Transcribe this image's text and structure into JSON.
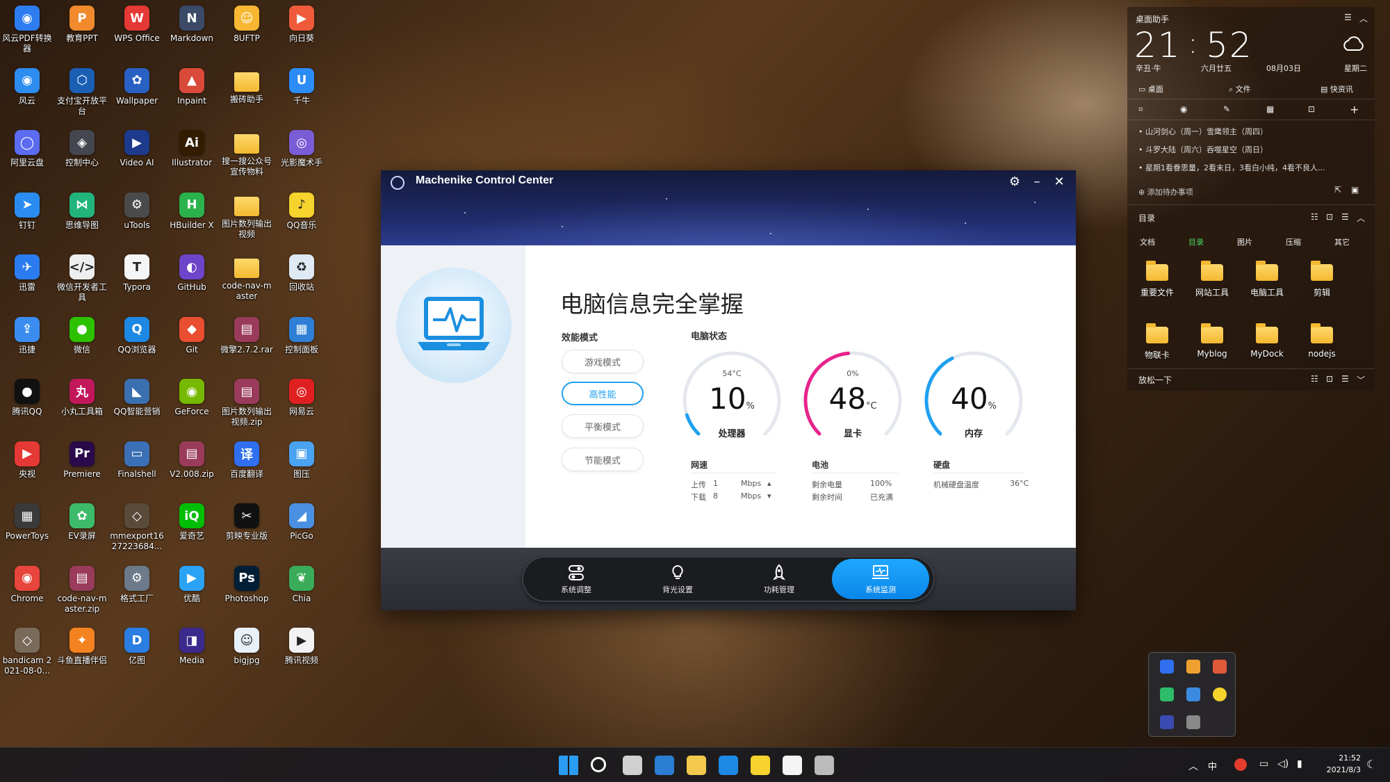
{
  "desktop": {
    "icons": [
      {
        "label": "风云PDF转换器",
        "icon": "pdf-converter-icon",
        "color": "#2d7cf0",
        "glyph": "◉"
      },
      {
        "label": "教育PPT",
        "icon": "edu-ppt-icon",
        "color": "#f08a2d",
        "glyph": "P"
      },
      {
        "label": "WPS Office",
        "icon": "wps-icon",
        "color": "#e53935",
        "glyph": "W"
      },
      {
        "label": "Markdown",
        "icon": "markdown-icon",
        "color": "#3b4a66",
        "glyph": "N"
      },
      {
        "label": "8UFTP",
        "icon": "ftp-icon",
        "color": "#f7b733",
        "glyph": "☺"
      },
      {
        "label": "向日葵",
        "icon": "sunflower-icon",
        "color": "#ef5b3a",
        "glyph": "▶"
      },
      {
        "label": "风云",
        "icon": "fengyun-icon",
        "color": "#2d8cf0",
        "glyph": "◉"
      },
      {
        "label": "支付宝开放平台",
        "icon": "alipay-dev-icon",
        "color": "#1a5fb4",
        "glyph": "⬡"
      },
      {
        "label": "Wallpaper",
        "icon": "wallpaper-icon",
        "color": "#2860c4",
        "glyph": "✿"
      },
      {
        "label": "Inpaint",
        "icon": "inpaint-icon",
        "color": "#d94a3a",
        "glyph": "▲"
      },
      {
        "label": "搬砖助手",
        "icon": "folder-icon",
        "color": "#f3c13a",
        "glyph": ""
      },
      {
        "label": "千牛",
        "icon": "qianniu-icon",
        "color": "#2b8cf5",
        "glyph": "U"
      },
      {
        "label": "阿里云盘",
        "icon": "aliyun-drive-icon",
        "color": "#5b6cf0",
        "glyph": "◯"
      },
      {
        "label": "控制中心",
        "icon": "control-center-icon",
        "color": "#44474f",
        "glyph": "◈"
      },
      {
        "label": "Video AI",
        "icon": "video-ai-icon",
        "color": "#1d3a8c",
        "glyph": "▶"
      },
      {
        "label": "Illustrator",
        "icon": "illustrator-icon",
        "color": "#331c00",
        "glyph": "Ai"
      },
      {
        "label": "搜一搜公众号宣传物料",
        "icon": "folder-icon",
        "color": "#f3c13a",
        "glyph": ""
      },
      {
        "label": "光影魔术手",
        "icon": "nevercenter-icon",
        "color": "#7a5cd6",
        "glyph": "◎"
      },
      {
        "label": "钉钉",
        "icon": "dingtalk-icon",
        "color": "#2a8cf0",
        "glyph": "➤"
      },
      {
        "label": "思维导图",
        "icon": "mindmap-icon",
        "color": "#21b47c",
        "glyph": "⋈"
      },
      {
        "label": "uTools",
        "icon": "utools-icon",
        "color": "#4a4a4a",
        "glyph": "⚙"
      },
      {
        "label": "HBuilder X",
        "icon": "hbuilder-icon",
        "color": "#2bb24c",
        "glyph": "H"
      },
      {
        "label": "图片数列输出视频",
        "icon": "folder-icon",
        "color": "#f3c13a",
        "glyph": ""
      },
      {
        "label": "QQ音乐",
        "icon": "qqmusic-icon",
        "color": "#f6d32d",
        "glyph": "♪"
      },
      {
        "label": "迅雷",
        "icon": "xunlei-icon",
        "color": "#2b7cf0",
        "glyph": "✈"
      },
      {
        "label": "微信开发者工具",
        "icon": "wechat-dev-icon",
        "color": "#eeeeee",
        "glyph": "</>"
      },
      {
        "label": "Typora",
        "icon": "typora-icon",
        "color": "#f5f5f5",
        "glyph": "T"
      },
      {
        "label": "GitHub",
        "icon": "github-icon",
        "color": "#6e44c9",
        "glyph": "◐"
      },
      {
        "label": "code-nav-master",
        "icon": "folder-icon",
        "color": "#f3c13a",
        "glyph": ""
      },
      {
        "label": "回收站",
        "icon": "recycle-bin-icon",
        "color": "#dfeaf5",
        "glyph": "♻"
      },
      {
        "label": "迅捷",
        "icon": "xunjie-icon",
        "color": "#3b8cf0",
        "glyph": "⇪"
      },
      {
        "label": "微信",
        "icon": "wechat-icon",
        "color": "#2dc100",
        "glyph": "●"
      },
      {
        "label": "QQ浏览器",
        "icon": "qq-browser-icon",
        "color": "#1e88e5",
        "glyph": "Q"
      },
      {
        "label": "Git",
        "icon": "git-icon",
        "color": "#e94e31",
        "glyph": "◆"
      },
      {
        "label": "微擎2.7.2.rar",
        "icon": "rar-archive-icon",
        "color": "#9a3b5b",
        "glyph": "▤"
      },
      {
        "label": "控制面板",
        "icon": "control-panel-icon",
        "color": "#2f7fd6",
        "glyph": "▦"
      },
      {
        "label": "腾讯QQ",
        "icon": "qq-icon",
        "color": "#111111",
        "glyph": "●"
      },
      {
        "label": "小丸工具箱",
        "icon": "xiaowan-icon",
        "color": "#c2185b",
        "glyph": "丸"
      },
      {
        "label": "QQ智能营销",
        "icon": "qq-marketing-icon",
        "color": "#3a6fb0",
        "glyph": "◣"
      },
      {
        "label": "GeForce",
        "icon": "geforce-icon",
        "color": "#76b900",
        "glyph": "◉"
      },
      {
        "label": "图片数列输出视频.zip",
        "icon": "zip-archive-icon",
        "color": "#9a3b5b",
        "glyph": "▤"
      },
      {
        "label": "网易云",
        "icon": "netease-music-icon",
        "color": "#e02020",
        "glyph": "◎"
      },
      {
        "label": "央视",
        "icon": "cctv-icon",
        "color": "#e53935",
        "glyph": "▶"
      },
      {
        "label": "Premiere",
        "icon": "premiere-icon",
        "color": "#2a0a4a",
        "glyph": "Pr"
      },
      {
        "label": "Finalshell",
        "icon": "finalshell-icon",
        "color": "#3b6fb6",
        "glyph": "▭"
      },
      {
        "label": "V2.008.zip",
        "icon": "zip-archive-icon",
        "color": "#9a3b5b",
        "glyph": "▤"
      },
      {
        "label": "百度翻译",
        "icon": "baidu-translate-icon",
        "color": "#2f6ff0",
        "glyph": "译"
      },
      {
        "label": "图压",
        "icon": "tuya-icon",
        "color": "#4aa3f0",
        "glyph": "▣"
      },
      {
        "label": "PowerToys",
        "icon": "powertoys-icon",
        "color": "#3a3a3a",
        "glyph": "▦"
      },
      {
        "label": "EV录屏",
        "icon": "ev-recorder-icon",
        "color": "#3dbb6a",
        "glyph": "✿"
      },
      {
        "label": "mmexport1627223684...",
        "icon": "image-file-icon",
        "color": "#5a4a3a",
        "glyph": "◇"
      },
      {
        "label": "爱奇艺",
        "icon": "iqiyi-icon",
        "color": "#00be06",
        "glyph": "iQ"
      },
      {
        "label": "剪映专业版",
        "icon": "jianying-icon",
        "color": "#111111",
        "glyph": "✂"
      },
      {
        "label": "PicGo",
        "icon": "picgo-icon",
        "color": "#4a90e2",
        "glyph": "◢"
      },
      {
        "label": "Chrome",
        "icon": "chrome-icon",
        "color": "#e8453c",
        "glyph": "◉"
      },
      {
        "label": "code-nav-master.zip",
        "icon": "zip-archive-icon",
        "color": "#9a3b5b",
        "glyph": "▤"
      },
      {
        "label": "格式工厂",
        "icon": "format-factory-icon",
        "color": "#6c7a89",
        "glyph": "⚙"
      },
      {
        "label": "优酷",
        "icon": "youku-icon",
        "color": "#2ba3f5",
        "glyph": "▶"
      },
      {
        "label": "Photoshop",
        "icon": "photoshop-icon",
        "color": "#001e36",
        "glyph": "Ps"
      },
      {
        "label": "Chia",
        "icon": "chia-icon",
        "color": "#3aac59",
        "glyph": "❦"
      },
      {
        "label": "bandicam 2021-08-0...",
        "icon": "image-file-icon",
        "color": "#7a6a5a",
        "glyph": "◇"
      },
      {
        "label": "斗鱼直播伴侣",
        "icon": "douyu-icon",
        "color": "#f58220",
        "glyph": "✦"
      },
      {
        "label": "亿图",
        "icon": "edraw-icon",
        "color": "#2a7de1",
        "glyph": "D"
      },
      {
        "label": "Media",
        "icon": "media-icon",
        "color": "#3b2a8c",
        "glyph": "◨"
      },
      {
        "label": "bigjpg",
        "icon": "bigjpg-icon",
        "color": "#e8f0f8",
        "glyph": "☺"
      },
      {
        "label": "腾讯视频",
        "icon": "tencent-video-icon",
        "color": "#f2f2f2",
        "glyph": "▶"
      }
    ]
  },
  "app": {
    "title": "Machenike Control Center",
    "main_title": "电脑信息完全掌握",
    "perf_mode_label": "效能模式",
    "status_label": "电脑状态",
    "modes": [
      "游戏模式",
      "高性能",
      "平衡模式",
      "节能模式"
    ],
    "active_mode": "高性能",
    "gauges": [
      {
        "name": "处理器",
        "top": "54°C",
        "value": "10",
        "unit": "%",
        "percent": 10,
        "color": "#1ea0f0"
      },
      {
        "name": "显卡",
        "top": "0%",
        "value": "48",
        "unit": "°C",
        "percent": 48,
        "color": "#e8248c"
      },
      {
        "name": "内存",
        "top": "",
        "value": "40",
        "unit": "%",
        "percent": 40,
        "color": "#1ea0f0"
      }
    ],
    "network": {
      "title": "网速",
      "upload_label": "上传",
      "upload_value": "1",
      "download_label": "下载",
      "download_value": "8",
      "unit": "Mbps"
    },
    "battery": {
      "title": "电池",
      "remaining_label": "剩余电量",
      "remaining_value": "100%",
      "time_label": "剩余时间",
      "time_value": "已充满"
    },
    "disk": {
      "title": "硬盘",
      "temp_label": "机械硬盘温度",
      "temp_value": "36°C"
    },
    "nav": [
      {
        "label": "系统调整",
        "icon": "toggle-switch-icon"
      },
      {
        "label": "背光设置",
        "icon": "lightbulb-icon"
      },
      {
        "label": "功耗管理",
        "icon": "rocket-icon"
      },
      {
        "label": "系统监测",
        "icon": "monitor-icon"
      }
    ],
    "active_nav": "系统监测"
  },
  "widget": {
    "title": "桌面助手",
    "time_h": "21",
    "time_m": "52",
    "lunar_year": "辛丑·牛",
    "lunar_date": "六月廿五",
    "date": "08月03日",
    "weekday": "星期二",
    "tabs": [
      "桌面",
      "文件",
      "快资讯"
    ],
    "todos": [
      "山河剑心（周一）雪鹰领主（周四）",
      "斗罗大陆（周六）吞噬星空（周日）",
      "星期1看眷思量，2看末日，3看白小纯，4看不良人..."
    ],
    "add_todo": "添加待办事项",
    "dir_title": "目录",
    "dir_tabs": [
      "文档",
      "目录",
      "图片",
      "压缩",
      "其它"
    ],
    "active_dir_tab": "目录",
    "folders": [
      "重要文件",
      "网站工具",
      "电脑工具",
      "剪辑",
      "物联卡",
      "Myblog",
      "MyDock",
      "nodejs"
    ],
    "relax_title": "放松一下"
  },
  "taskbar": {
    "apps": [
      "windows-start-icon",
      "search-icon",
      "task-view-icon",
      "widgets-icon",
      "file-explorer-icon",
      "qq-browser-icon",
      "qqmusic-icon",
      "typora-icon",
      "control-center-icon"
    ],
    "ime": "中",
    "time": "21:52",
    "date": "2021/8/3"
  }
}
